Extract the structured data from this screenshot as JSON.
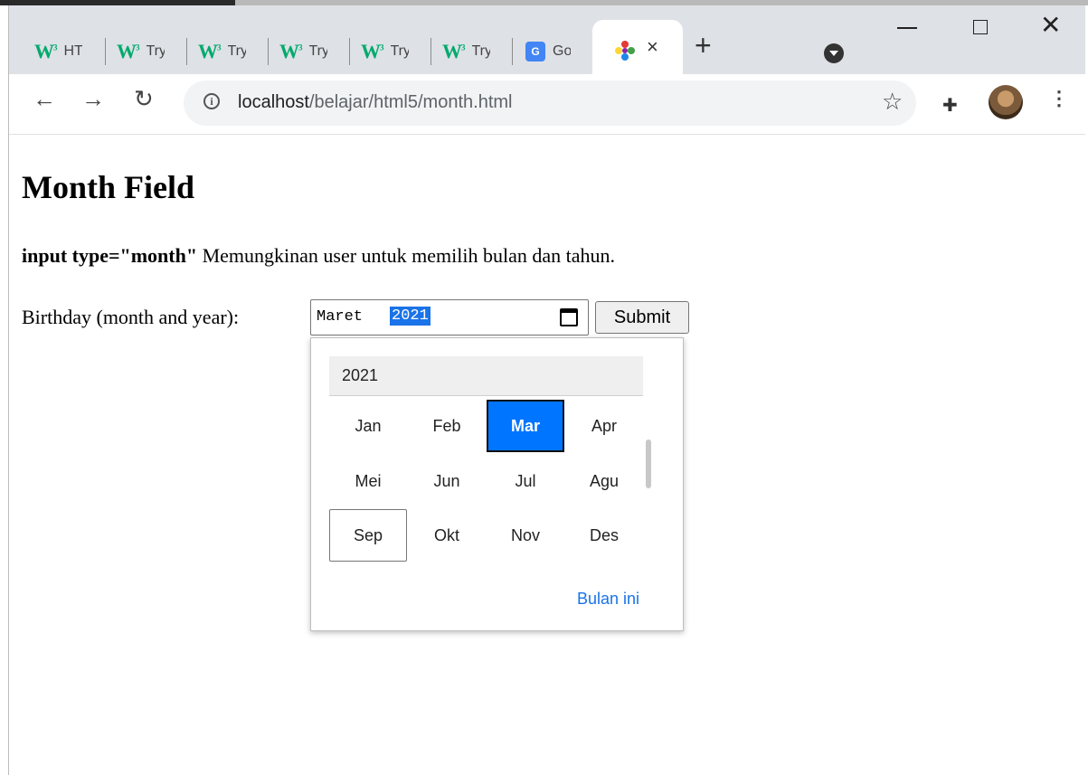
{
  "browser": {
    "tabs": [
      {
        "favicon": "w3schools-icon",
        "title": "HT"
      },
      {
        "favicon": "w3schools-icon",
        "title": "Try"
      },
      {
        "favicon": "w3schools-icon",
        "title": "Try"
      },
      {
        "favicon": "w3schools-icon",
        "title": "Try"
      },
      {
        "favicon": "w3schools-icon",
        "title": "Try"
      },
      {
        "favicon": "w3schools-icon",
        "title": "Try"
      },
      {
        "favicon": "google-translate-icon",
        "title": "Go"
      }
    ],
    "active_tab": {
      "favicon": "pinwheel-icon",
      "close": "×"
    },
    "new_tab": "+",
    "url_host": "localhost",
    "url_path": "/belajar/html5/month.html"
  },
  "page": {
    "heading": "Month Field",
    "desc_code": "input type=\"month\"",
    "desc_text": " Memungkinan user untuk memilih bulan dan tahun.",
    "label": "Birthday (month and year):",
    "input_month": "Maret",
    "input_year": "2021",
    "submit": "Submit"
  },
  "picker": {
    "year": "2021",
    "months": [
      "Jan",
      "Feb",
      "Mar",
      "Apr",
      "Mei",
      "Jun",
      "Jul",
      "Agu",
      "Sep",
      "Okt",
      "Nov",
      "Des"
    ],
    "selected": "Mar",
    "focused": "Sep",
    "this_month": "Bulan ini"
  },
  "colors": {
    "accent": "#0075ff",
    "link": "#1a73e8",
    "w3green": "#04aa6d"
  }
}
